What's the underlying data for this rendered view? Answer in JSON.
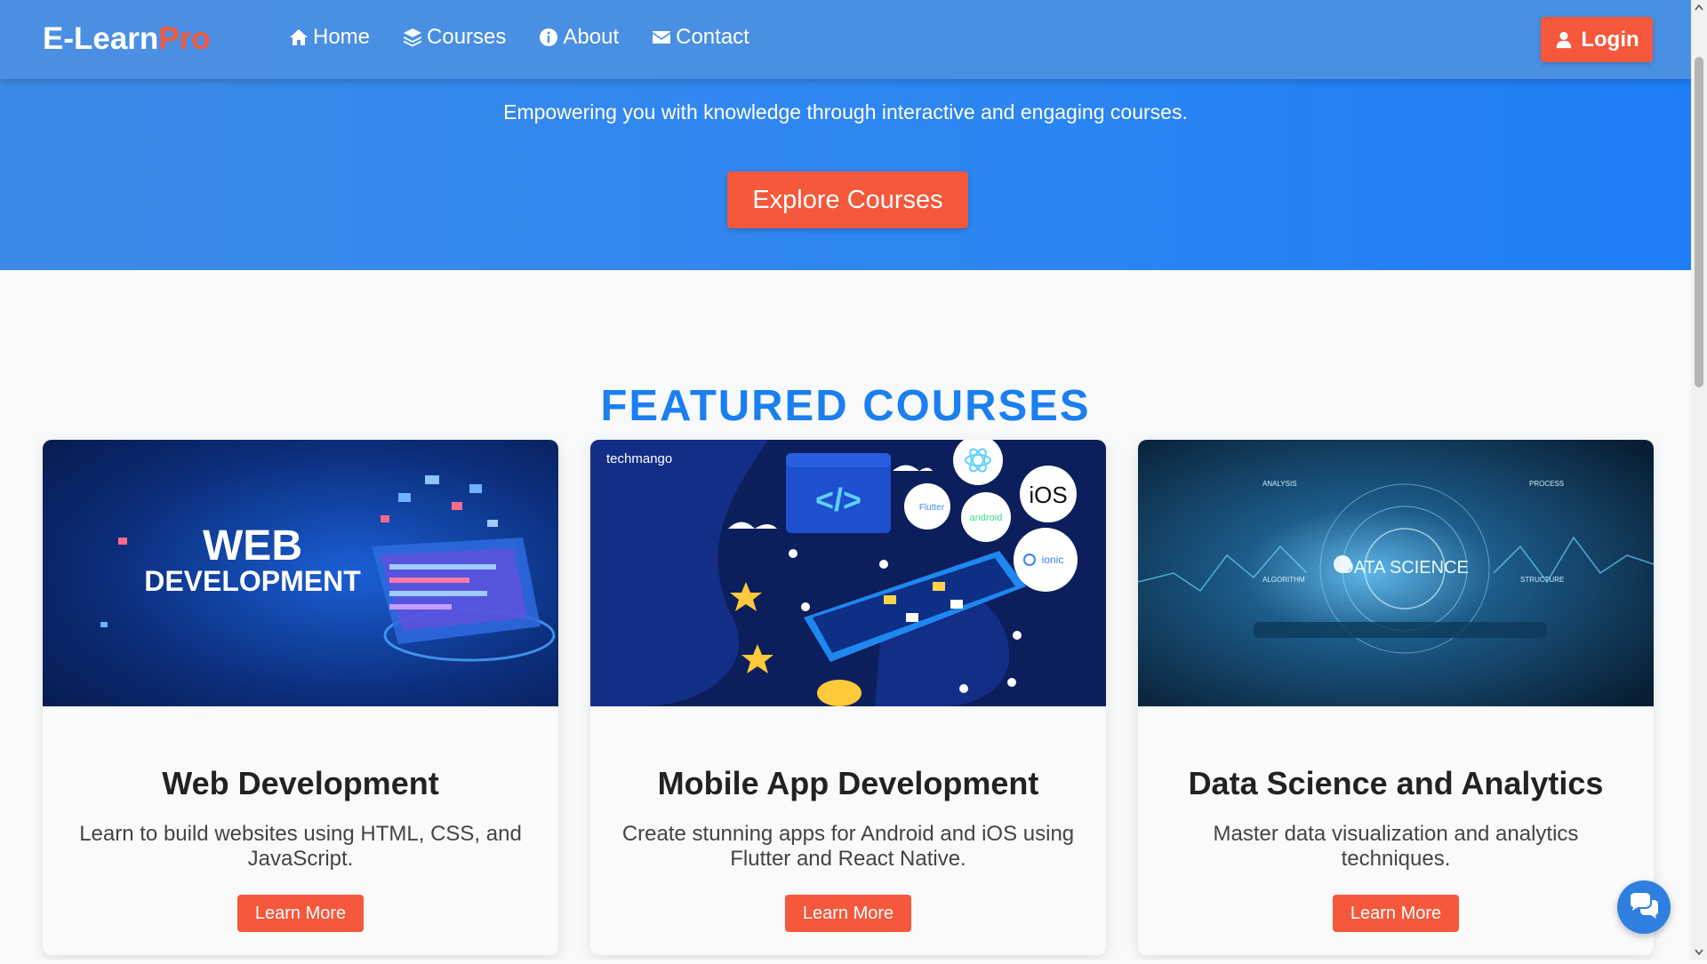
{
  "navbar": {
    "brand_main": "E-Learn",
    "brand_accent": "Pro",
    "links": [
      {
        "label": "Home",
        "icon": "home-icon"
      },
      {
        "label": "Courses",
        "icon": "layers-icon"
      },
      {
        "label": "About",
        "icon": "info-icon"
      },
      {
        "label": "Contact",
        "icon": "envelope-icon"
      }
    ],
    "login_label": "Login"
  },
  "hero": {
    "subtitle": "Empowering you with knowledge through interactive and engaging courses.",
    "cta_label": "Explore Courses"
  },
  "featured": {
    "title": "FEATURED COURSES",
    "courses": [
      {
        "title": "Web Development",
        "description": "Learn to build websites using HTML, CSS, and JavaScript.",
        "button": "Learn More",
        "image_text_1": "WEB",
        "image_text_2": "DEVELOPMENT"
      },
      {
        "title": "Mobile App Development",
        "description": "Create stunning apps for Android and iOS using Flutter and React Native.",
        "button": "Learn More",
        "image_brand": "techmango",
        "image_code": "</>",
        "image_badges": [
          "iOS",
          "Flutter",
          "android",
          "ionic"
        ]
      },
      {
        "title": "Data Science and Analytics",
        "description": "Master data visualization and analytics techniques.",
        "button": "Learn More",
        "image_text": "DATA SCIENCE",
        "image_labels": [
          "ANALYSIS",
          "PROCESS",
          "ALGORITHM",
          "STRUCTURE"
        ]
      }
    ]
  },
  "colors": {
    "primary": "#4a90e2",
    "accent": "#f6583b",
    "title_blue": "#1a7ff0"
  },
  "widgets": {
    "chat_icon": "chat-bubbles-icon"
  }
}
